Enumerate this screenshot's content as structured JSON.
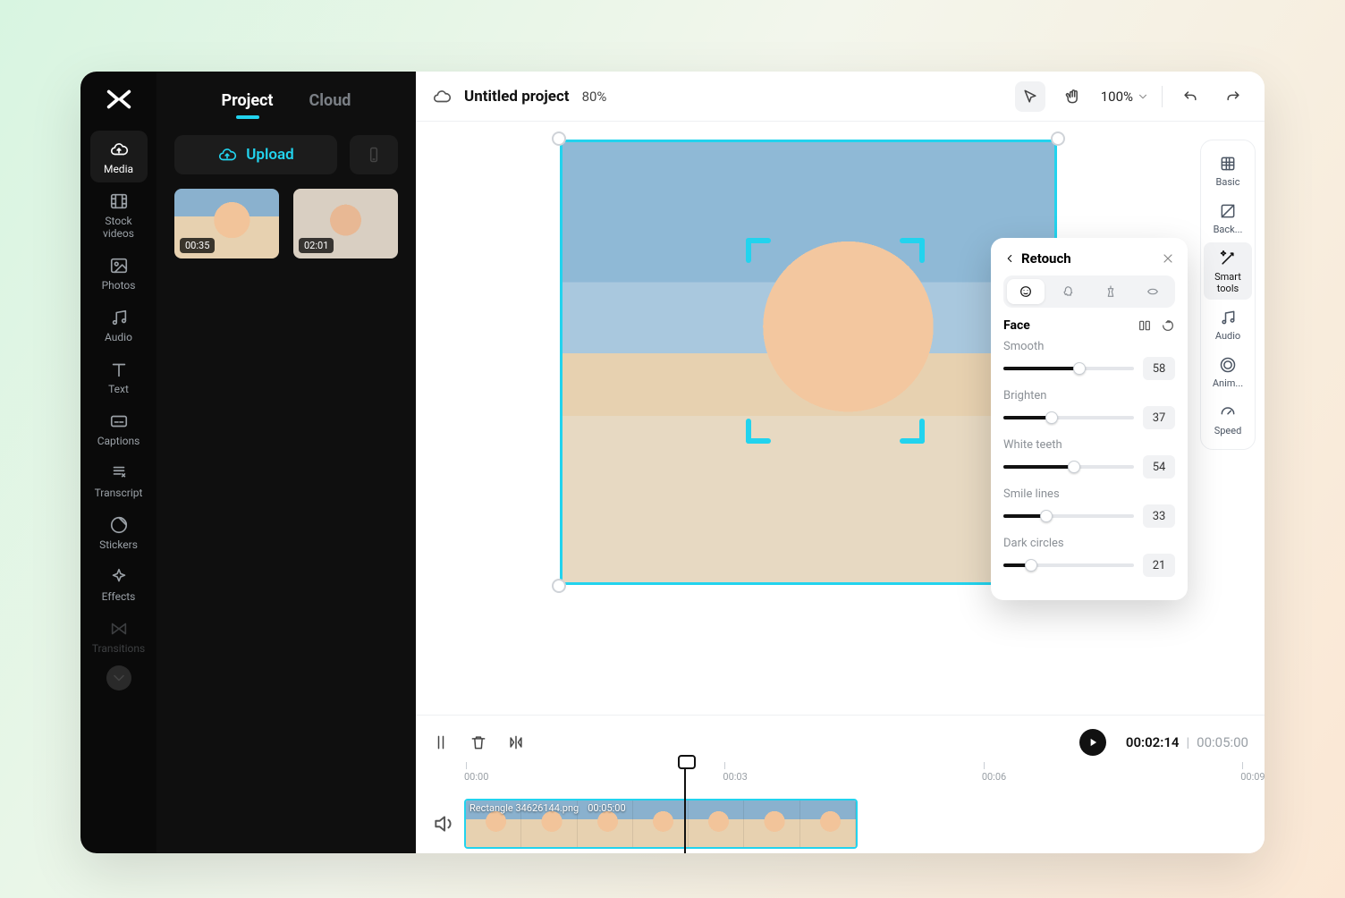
{
  "rail": {
    "items": [
      {
        "id": "media",
        "label": "Media"
      },
      {
        "id": "stock",
        "label": "Stock\nvideos"
      },
      {
        "id": "photos",
        "label": "Photos"
      },
      {
        "id": "audio",
        "label": "Audio"
      },
      {
        "id": "text",
        "label": "Text"
      },
      {
        "id": "captions",
        "label": "Captions"
      },
      {
        "id": "transcript",
        "label": "Transcript"
      },
      {
        "id": "stickers",
        "label": "Stickers"
      },
      {
        "id": "effects",
        "label": "Effects"
      },
      {
        "id": "transitions",
        "label": "Transitions"
      }
    ],
    "active": "media"
  },
  "panel": {
    "tabs": {
      "project": "Project",
      "cloud": "Cloud",
      "active": "project"
    },
    "upload_label": "Upload",
    "clips": [
      {
        "duration": "00:35"
      },
      {
        "duration": "02:01"
      }
    ]
  },
  "topbar": {
    "title": "Untitled project",
    "progress": "80%",
    "zoom": "100%"
  },
  "quickrail": [
    "Basic",
    "Back...",
    "Smart tools",
    "Audio",
    "Anim...",
    "Speed"
  ],
  "quickrail_active": 2,
  "retouch": {
    "title": "Retouch",
    "category": "Face",
    "params": [
      {
        "label": "Smooth",
        "value": 58
      },
      {
        "label": "Brighten",
        "value": 37
      },
      {
        "label": "White teeth",
        "value": 54
      },
      {
        "label": "Smile lines",
        "value": 33
      },
      {
        "label": "Dark circles",
        "value": 21
      }
    ]
  },
  "timeline": {
    "current": "00:02:14",
    "total": "00:05:00",
    "ruler": [
      "00:00",
      "00:03",
      "00:06",
      "00:09"
    ],
    "clip": {
      "name": "Rectangle 34626144.png",
      "dur": "00:05:00"
    },
    "playhead_pct": 28
  }
}
